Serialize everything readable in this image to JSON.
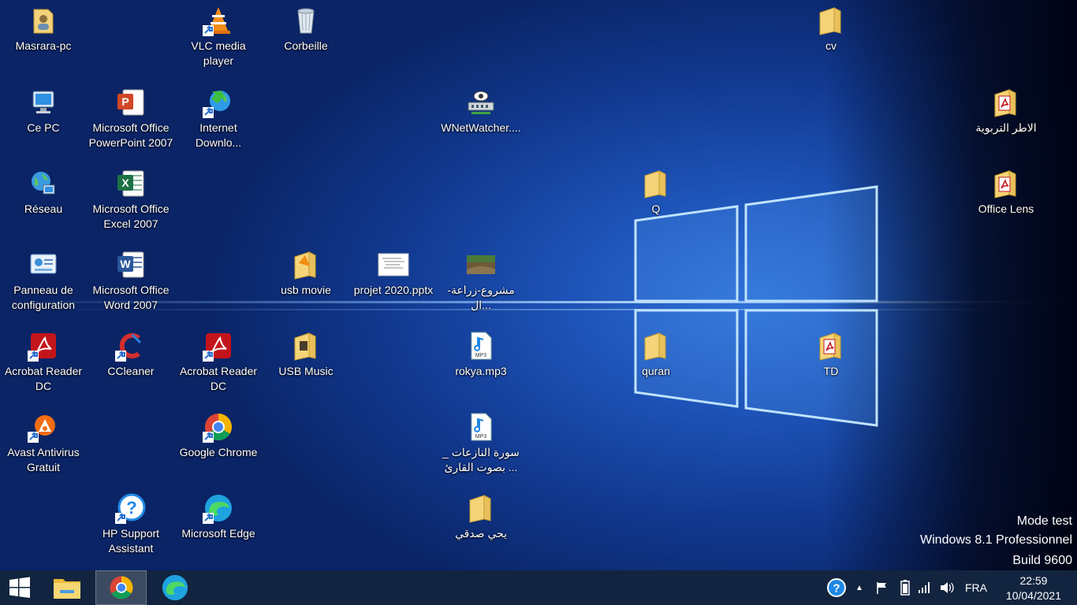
{
  "desktop": {
    "icons": {
      "masrara_pc": "Masrara-pc",
      "vlc": "VLC media player",
      "corbeille": "Corbeille",
      "cv": "cv",
      "ce_pc": "Ce PC",
      "powerpoint": "Microsoft Office PowerPoint 2007",
      "idm": "Internet Downlo...",
      "wnetwatcher": "WNetWatcher....",
      "atr": "الاطر التربوية",
      "reseau": "Réseau",
      "excel": "Microsoft Office Excel 2007",
      "q": "Q",
      "office_lens": "Office Lens",
      "panneau": "Panneau de configuration",
      "word": "Microsoft Office Word 2007",
      "usb_movie": "usb movie",
      "projet": "projet 2020.pptx",
      "mashrou": "مشروع-زراعة-ال...",
      "acrobat1": "Acrobat Reader DC",
      "ccleaner": "CCleaner",
      "acrobat2": "Acrobat Reader DC",
      "usb_music": "USB Music",
      "rokya": "rokya.mp3",
      "quran": "quran",
      "td": "TD",
      "avast": "Avast Antivirus Gratuit",
      "chrome": "Google Chrome",
      "surat": "سورة النازعات _ بصوت القارئ ...",
      "hp": "HP Support Assistant",
      "edge": "Microsoft Edge",
      "yahya": "يحي صدقي"
    }
  },
  "watermark": {
    "line1": "Mode test",
    "line2": "Windows 8.1 Professionnel",
    "line3": "Build 9600"
  },
  "taskbar": {
    "language": "FRA",
    "time": "22:59",
    "date": "10/04/2021"
  },
  "colors": {
    "taskbar": "#12243f",
    "desktop_blue": "#1d52b6"
  }
}
